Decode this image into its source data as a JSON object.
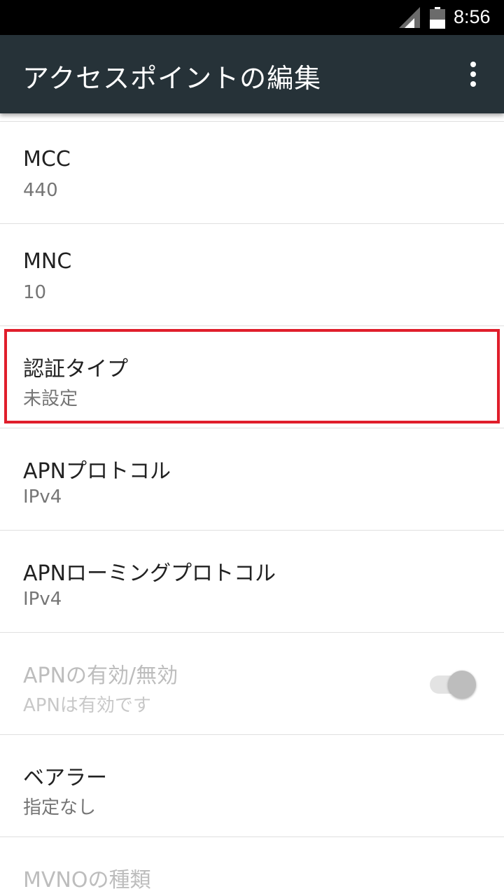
{
  "status_bar": {
    "time": "8:56",
    "icons": [
      "signal-icon",
      "battery-icon"
    ]
  },
  "app_bar": {
    "title": "アクセスポイントの編集",
    "overflow_icon": "more-vert-icon"
  },
  "preferences": [
    {
      "title": "MCC",
      "summary": "440",
      "enabled": true
    },
    {
      "title": "MNC",
      "summary": "10",
      "enabled": true
    },
    {
      "title": "認証タイプ",
      "summary": "未設定",
      "enabled": true,
      "highlighted": true
    },
    {
      "title": "APNプロトコル",
      "summary": "IPv4",
      "enabled": true
    },
    {
      "title": "APNローミングプロトコル",
      "summary": "IPv4",
      "enabled": true
    },
    {
      "title": "APNの有効/無効",
      "summary": "APNは有効です",
      "enabled": false,
      "toggle": {
        "checked": true
      }
    },
    {
      "title": "ベアラー",
      "summary": "指定なし",
      "enabled": true
    },
    {
      "title": "MVNOの種類",
      "summary": "",
      "enabled": false
    }
  ],
  "colors": {
    "app_bar": "#263238",
    "status_bar": "#000000",
    "highlight_border": "#e01e2b",
    "divider": "#e0e0e0"
  }
}
